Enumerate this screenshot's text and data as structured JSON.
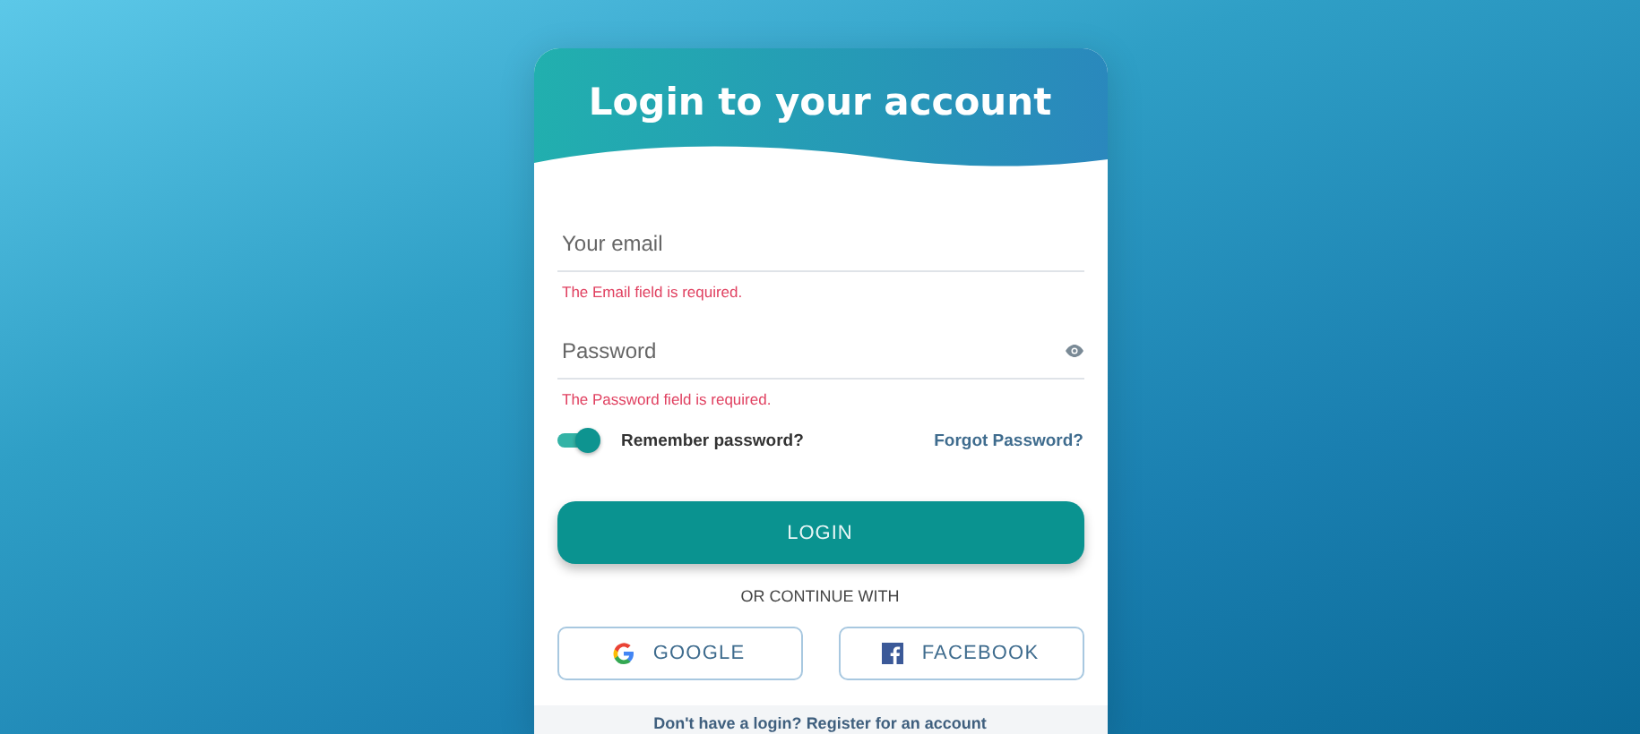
{
  "title": "Login to your account",
  "email": {
    "placeholder": "Your email",
    "error": "The Email field is required."
  },
  "password": {
    "placeholder": "Password",
    "error": "The Password field is required."
  },
  "remember": {
    "label": "Remember password?",
    "on": true
  },
  "forgot_link": "Forgot Password?",
  "login_button": "LOGIN",
  "divider_text": "OR CONTINUE WITH",
  "social_buttons": [
    {
      "kind": "google",
      "label": "GOOGLE"
    },
    {
      "kind": "facebook",
      "label": "FACEBOOK"
    }
  ],
  "footer": {
    "prompt": "Don't have a login?",
    "link": "Register for an account"
  }
}
